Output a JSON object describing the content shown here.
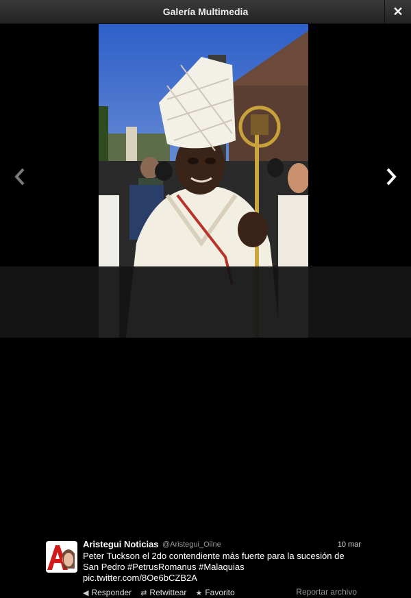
{
  "header": {
    "title": "Galería Multimedia",
    "close_icon": "close-icon"
  },
  "gallery": {
    "prev_icon": "chevron-left-icon",
    "next_icon": "chevron-right-icon"
  },
  "tweet": {
    "name": "Aristegui Noticias",
    "handle": "@Aristegui_Oilne",
    "date": "10 mar",
    "text_lines": [
      "Peter Tuckson el 2do contendiente más fuerte para la sucesión de",
      "San Pedro #PetrusRomanus #Malaquias",
      "pic.twitter.com/8Oe6bCZB2A"
    ],
    "actions": {
      "reply": "Responder",
      "retweet": "Retwittear",
      "favorite": "Favorito"
    },
    "report": "Reportar archivo"
  }
}
